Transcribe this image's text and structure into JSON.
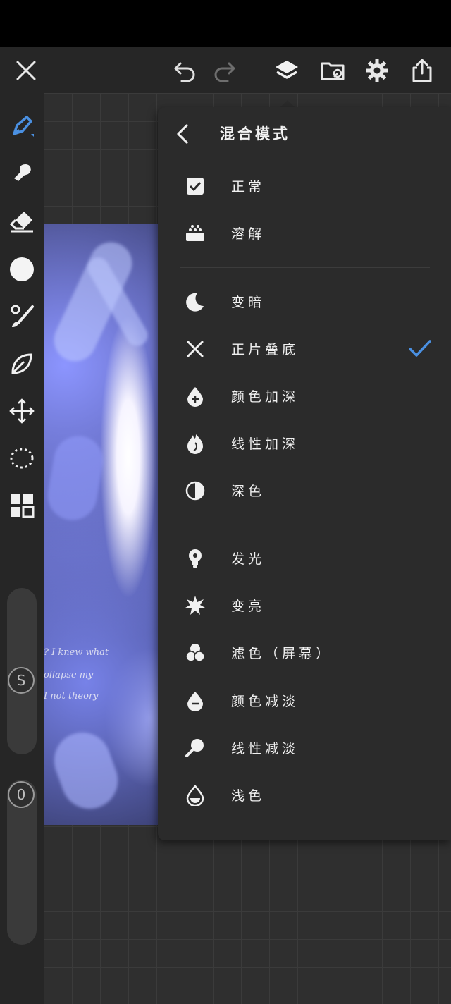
{
  "toolbar": {
    "close_icon": "close-icon",
    "undo_icon": "undo-icon",
    "redo_icon": "redo-icon",
    "layers_icon": "layers-icon",
    "gallery_icon": "folder-image-icon",
    "settings_icon": "gear-icon",
    "share_icon": "share-icon"
  },
  "sidebar": {
    "tools": [
      "brush-icon",
      "smudge-icon",
      "eraser-icon",
      "color-icon",
      "brush-settings-icon",
      "liquify-icon",
      "transform-icon",
      "lasso-icon",
      "grid-icon"
    ],
    "size_badge": "S",
    "opacity_badge": "0"
  },
  "artwork": {
    "text_lines": [
      "? I knew what",
      "ollapse my",
      "I not theory"
    ]
  },
  "panel": {
    "title": "混合模式",
    "modes": [
      {
        "label": "正常",
        "icon": "checkbox-icon",
        "selected": false
      },
      {
        "label": "溶解",
        "icon": "dissolve-icon",
        "selected": false
      },
      {
        "label": "变暗",
        "icon": "moon-icon",
        "selected": false
      },
      {
        "label": "正片叠底",
        "icon": "multiply-x-icon",
        "selected": true
      },
      {
        "label": "颜色加深",
        "icon": "drop-plus-icon",
        "selected": false
      },
      {
        "label": "线性加深",
        "icon": "flame-icon",
        "selected": false
      },
      {
        "label": "深色",
        "icon": "half-circle-icon",
        "selected": false
      },
      {
        "label": "发光",
        "icon": "bulb-icon",
        "selected": false
      },
      {
        "label": "变亮",
        "icon": "sparkle-icon",
        "selected": false
      },
      {
        "label": "滤色（屏幕）",
        "icon": "screen-circles-icon",
        "selected": false
      },
      {
        "label": "颜色减淡",
        "icon": "drop-minus-icon",
        "selected": false
      },
      {
        "label": "线性减淡",
        "icon": "magnifier-icon",
        "selected": false
      },
      {
        "label": "浅色",
        "icon": "droplet-outline-icon",
        "selected": false
      }
    ]
  },
  "colors": {
    "accent": "#4a90e2",
    "panel_bg": "#2b2b2b",
    "toolbar_bg": "#262626"
  }
}
